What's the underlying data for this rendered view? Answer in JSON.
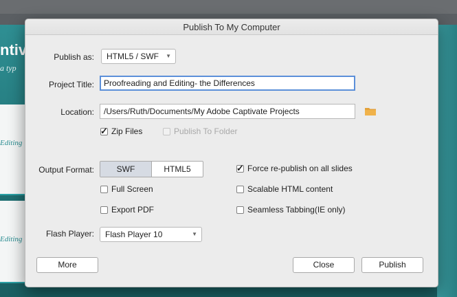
{
  "background": {
    "title_text": "ntiv",
    "subtitle_text": "a typ",
    "card_texts": [
      "Editing",
      "Editing"
    ]
  },
  "dialog": {
    "title": "Publish To My Computer",
    "publish_as": {
      "label": "Publish as:",
      "value": "HTML5 / SWF"
    },
    "project_title": {
      "label": "Project Title:",
      "value": "Proofreading and Editing- the Differences"
    },
    "location": {
      "label": "Location:",
      "value": "/Users/Ruth/Documents/My Adobe Captivate Projects",
      "browse_icon": "folder-icon"
    },
    "zip_files": {
      "label": "Zip Files",
      "checked": true
    },
    "publish_to_folder": {
      "label": "Publish To Folder",
      "checked": false,
      "enabled": false
    },
    "output_format": {
      "label": "Output Format:",
      "options": [
        "SWF",
        "HTML5"
      ],
      "selected": "SWF"
    },
    "full_screen": {
      "label": "Full Screen",
      "checked": false
    },
    "export_pdf": {
      "label": "Export PDF",
      "checked": false
    },
    "force_republish": {
      "label": "Force re-publish on all slides",
      "checked": true
    },
    "scalable_html": {
      "label": "Scalable HTML content",
      "checked": false
    },
    "seamless_tabbing": {
      "label": "Seamless Tabbing(IE only)",
      "checked": false
    },
    "flash_player": {
      "label": "Flash Player:",
      "value": "Flash Player 10"
    },
    "buttons": {
      "more": "More",
      "close": "Close",
      "publish": "Publish"
    }
  },
  "colors": {
    "accent_focus": "#5b8fd9",
    "folder": "#e3a13a",
    "teal": "#2f8f93"
  }
}
